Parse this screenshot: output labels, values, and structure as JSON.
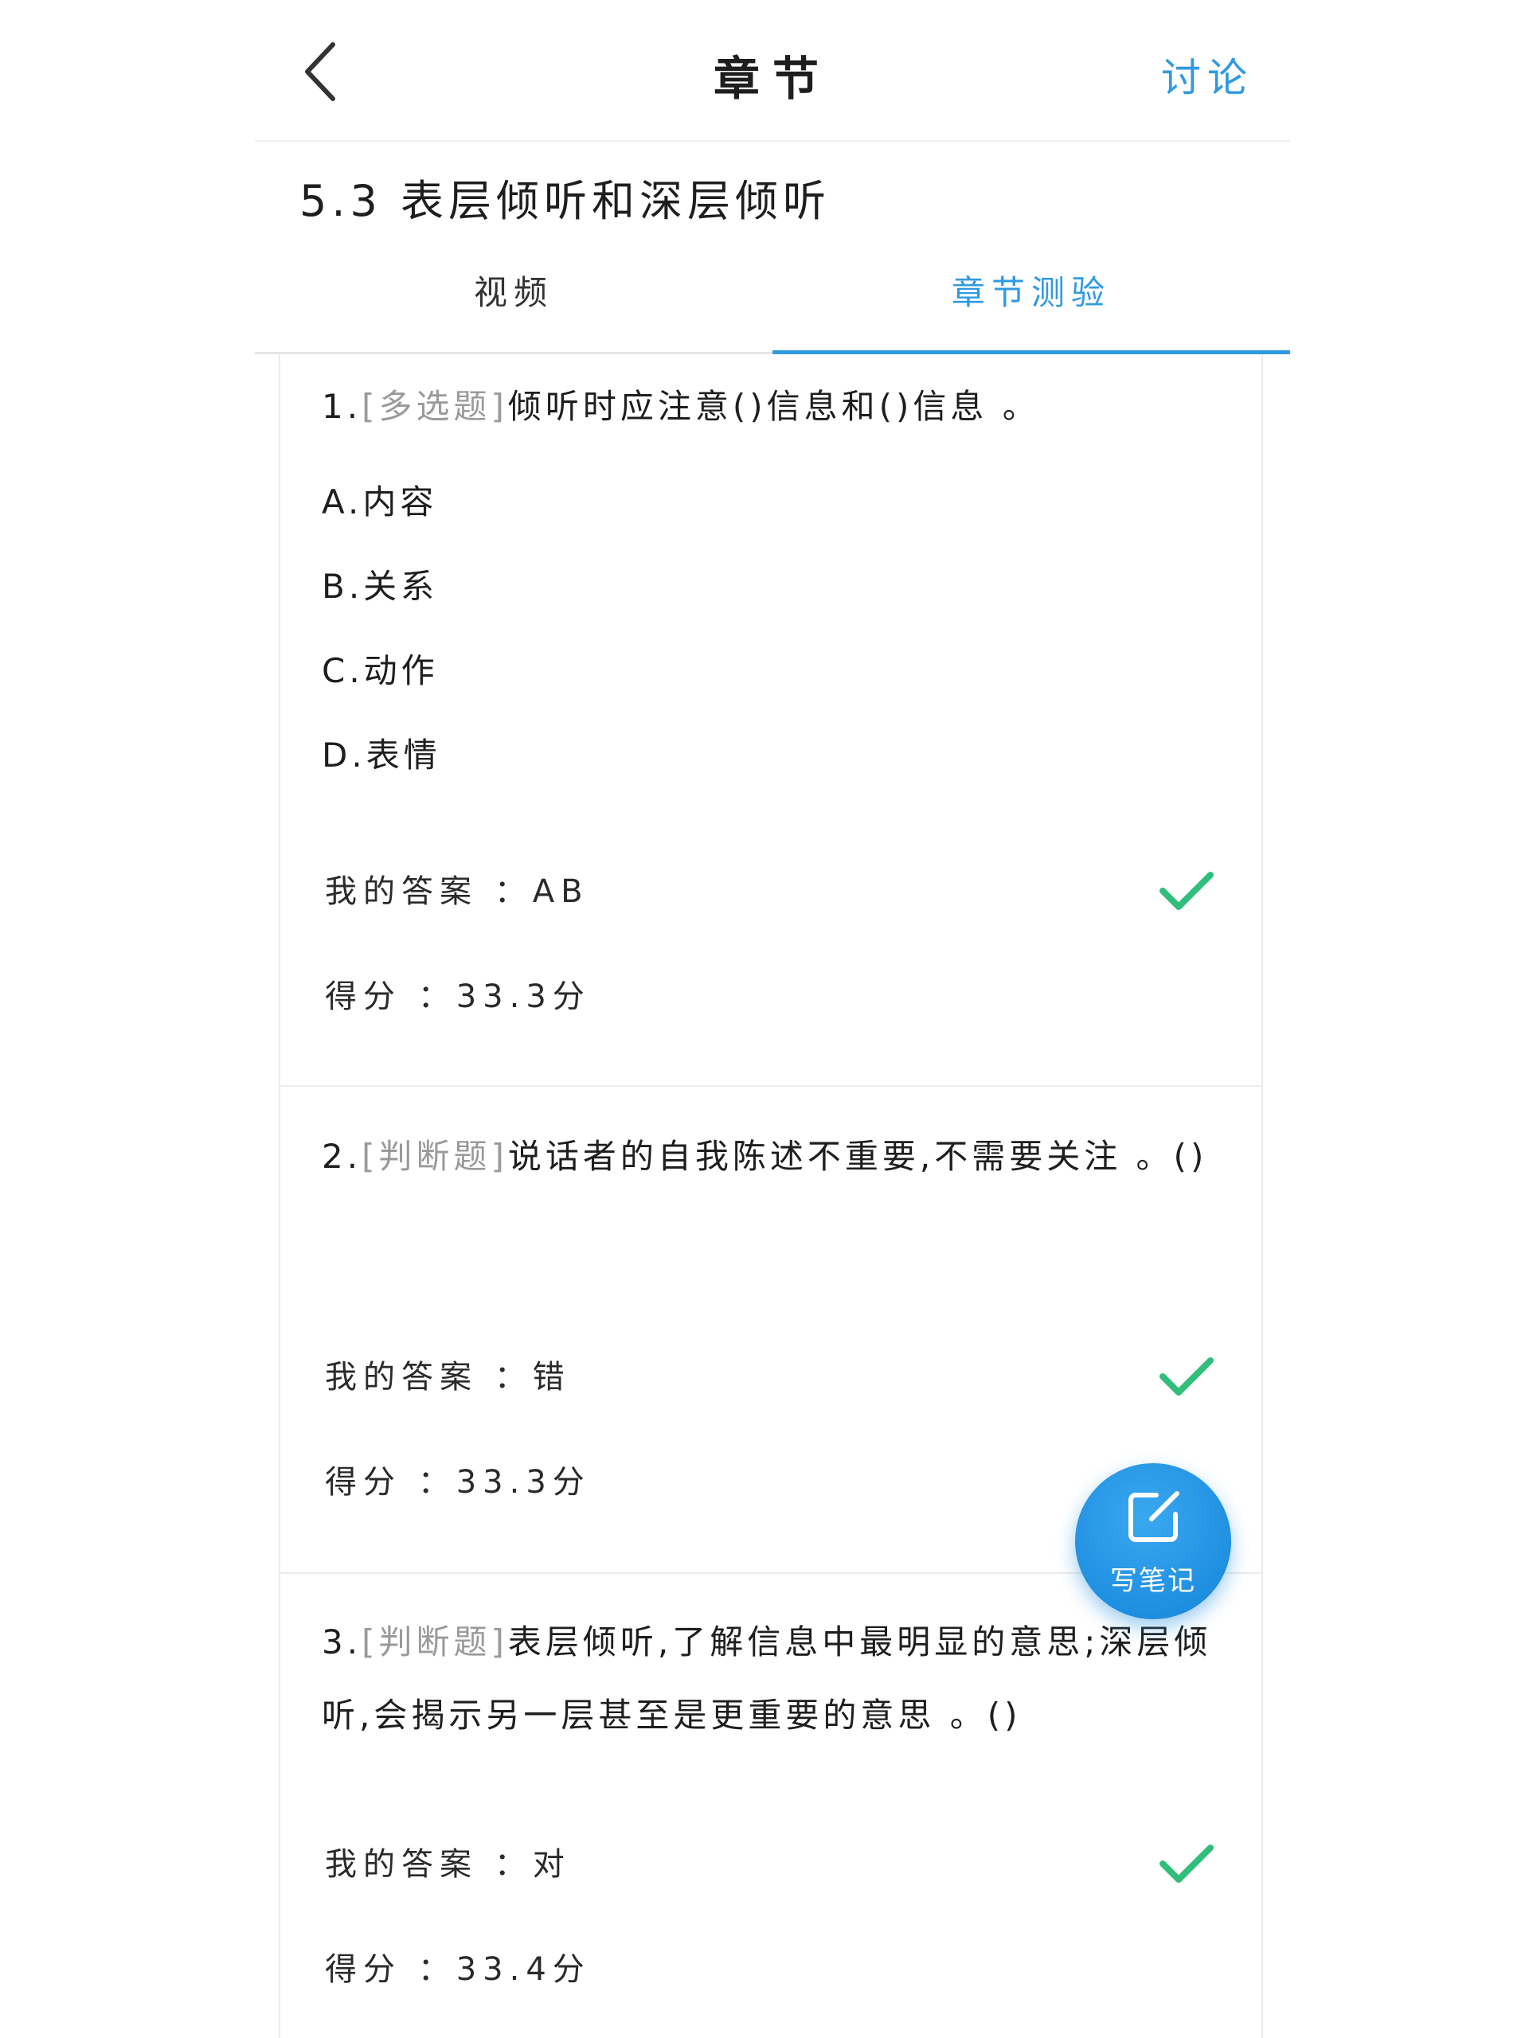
{
  "header": {
    "title": "章节",
    "discuss_label": "讨论"
  },
  "chapter": {
    "title": "5.3 表层倾听和深层倾听"
  },
  "tabs": [
    {
      "label": "视频",
      "active": false
    },
    {
      "label": "章节测验",
      "active": true
    }
  ],
  "questions": [
    {
      "number": "1.",
      "type": "[多选题]",
      "stem": "倾听时应注意()信息和()信息 。",
      "options": [
        "A.内容",
        "B.关系",
        "C.动作",
        "D.表情"
      ],
      "answer_text": "我的答案 ：AB",
      "score_text": "得分 ：33.3分",
      "correct": true
    },
    {
      "number": "2.",
      "type": "[判断题]",
      "stem": "说话者的自我陈述不重要,不需要关注 。()",
      "options": [],
      "answer_text": "我的答案 ：错",
      "score_text": "得分 ：33.3分",
      "correct": true
    },
    {
      "number": "3.",
      "type": "[判断题]",
      "stem": "表层倾听,了解信息中最明显的意思;深层倾听,会揭示另一层甚至是更重要的意思 。()",
      "options": [],
      "answer_text": "我的答案 ：对",
      "score_text": "得分 ：33.4分",
      "correct": true
    }
  ],
  "note_button": {
    "label": "写笔记"
  },
  "colors": {
    "accent": "#2f9ae0",
    "correct": "#2fbf7a",
    "question_type": "#9a9a9a"
  },
  "icons": {
    "back": "chevron-left-icon",
    "correct": "check-icon",
    "note": "edit-note-icon"
  }
}
